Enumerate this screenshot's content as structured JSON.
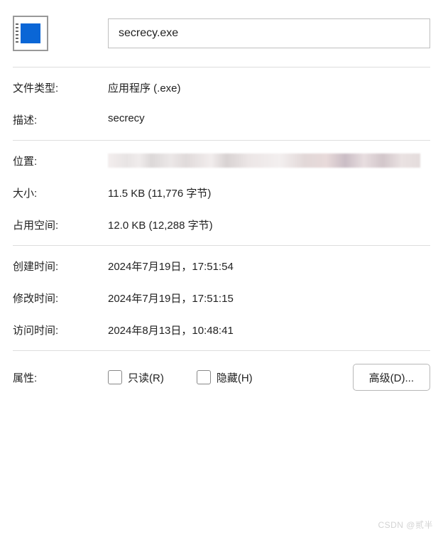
{
  "header": {
    "filename": "secrecy.exe"
  },
  "fields": {
    "fileTypeLabel": "文件类型:",
    "fileTypeValue": "应用程序 (.exe)",
    "descriptionLabel": "描述:",
    "descriptionValue": "secrecy",
    "locationLabel": "位置:",
    "sizeLabel": "大小:",
    "sizeValue": "11.5 KB (11,776 字节)",
    "diskSizeLabel": "占用空间:",
    "diskSizeValue": "12.0 KB (12,288 字节)",
    "createdLabel": "创建时间:",
    "createdValue": "2024年7月19日，17:51:54",
    "modifiedLabel": "修改时间:",
    "modifiedValue": "2024年7月19日，17:51:15",
    "accessedLabel": "访问时间:",
    "accessedValue": "2024年8月13日，10:48:41"
  },
  "attributes": {
    "label": "属性:",
    "readonlyLabel": "只读(R)",
    "hiddenLabel": "隐藏(H)",
    "advancedButton": "高级(D)..."
  },
  "watermark": "CSDN @贰半"
}
